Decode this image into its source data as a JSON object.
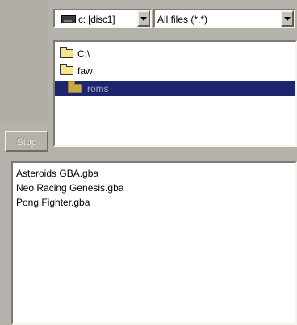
{
  "drive_selector": {
    "value": "c: [disc1]",
    "icon": "drive-icon"
  },
  "filter_selector": {
    "value": "All files (*.*)"
  },
  "directory_tree": {
    "items": [
      {
        "label": "C:\\",
        "icon": "open-folder-icon",
        "selected": false
      },
      {
        "label": "faw",
        "icon": "open-folder-icon",
        "selected": false
      },
      {
        "label": "roms",
        "icon": "folder-icon",
        "selected": true
      }
    ]
  },
  "stop_button": {
    "label": "Stop",
    "enabled": false
  },
  "file_list": {
    "items": [
      "Asteroids GBA.gba",
      "Neo Racing Genesis.gba",
      "Pong Fighter.gba"
    ]
  },
  "colors": {
    "selection_bg": "#1c2670",
    "window_bg": "#b4b2aa"
  }
}
